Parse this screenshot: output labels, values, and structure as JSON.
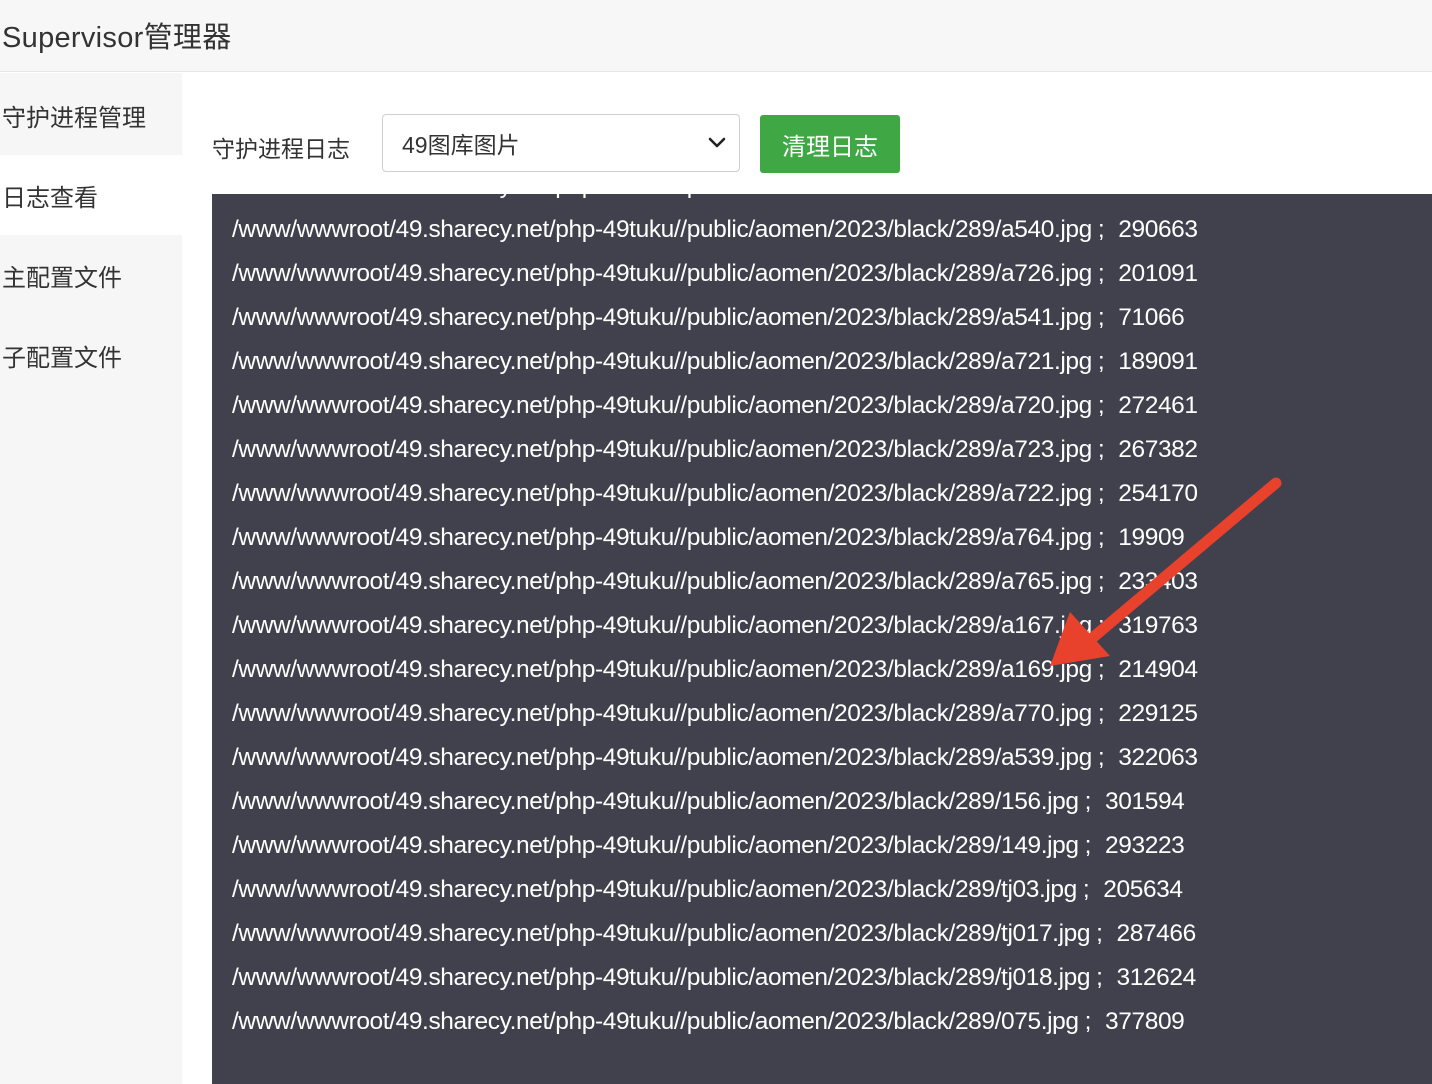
{
  "app": {
    "title": "Supervisor管理器"
  },
  "sidebar": {
    "items": [
      {
        "label": "守护进程管理"
      },
      {
        "label": "日志查看"
      },
      {
        "label": "主配置文件"
      },
      {
        "label": "子配置文件"
      }
    ]
  },
  "toolbar": {
    "label": "守护进程日志",
    "select_value": "49图库图片",
    "clear_label": "清理日志",
    "accent_color": "#3fa845"
  },
  "log": {
    "background": "#41414d",
    "lines": [
      {
        "path": "/www/wwwroot/49.sharecy.net/php-49tuku//public/aomen/2023/black/289/a540.jpg",
        "sep": ";",
        "size": "290663"
      },
      {
        "path": "/www/wwwroot/49.sharecy.net/php-49tuku//public/aomen/2023/black/289/a726.jpg",
        "sep": ";",
        "size": "201091"
      },
      {
        "path": "/www/wwwroot/49.sharecy.net/php-49tuku//public/aomen/2023/black/289/a541.jpg",
        "sep": ";",
        "size": "71066"
      },
      {
        "path": "/www/wwwroot/49.sharecy.net/php-49tuku//public/aomen/2023/black/289/a721.jpg",
        "sep": ";",
        "size": "189091"
      },
      {
        "path": "/www/wwwroot/49.sharecy.net/php-49tuku//public/aomen/2023/black/289/a720.jpg",
        "sep": ";",
        "size": "272461"
      },
      {
        "path": "/www/wwwroot/49.sharecy.net/php-49tuku//public/aomen/2023/black/289/a723.jpg",
        "sep": ";",
        "size": "267382"
      },
      {
        "path": "/www/wwwroot/49.sharecy.net/php-49tuku//public/aomen/2023/black/289/a722.jpg",
        "sep": ";",
        "size": "254170"
      },
      {
        "path": "/www/wwwroot/49.sharecy.net/php-49tuku//public/aomen/2023/black/289/a764.jpg",
        "sep": ";",
        "size": "19909"
      },
      {
        "path": "/www/wwwroot/49.sharecy.net/php-49tuku//public/aomen/2023/black/289/a765.jpg",
        "sep": ";",
        "size": "233403"
      },
      {
        "path": "/www/wwwroot/49.sharecy.net/php-49tuku//public/aomen/2023/black/289/a167.jpg",
        "sep": ";",
        "size": "319763"
      },
      {
        "path": "/www/wwwroot/49.sharecy.net/php-49tuku//public/aomen/2023/black/289/a169.jpg",
        "sep": ";",
        "size": "214904"
      },
      {
        "path": "/www/wwwroot/49.sharecy.net/php-49tuku//public/aomen/2023/black/289/a770.jpg",
        "sep": ";",
        "size": "229125"
      },
      {
        "path": "/www/wwwroot/49.sharecy.net/php-49tuku//public/aomen/2023/black/289/a539.jpg",
        "sep": ";",
        "size": "322063"
      },
      {
        "path": "/www/wwwroot/49.sharecy.net/php-49tuku//public/aomen/2023/black/289/156.jpg",
        "sep": ";",
        "size": "301594"
      },
      {
        "path": "/www/wwwroot/49.sharecy.net/php-49tuku//public/aomen/2023/black/289/149.jpg",
        "sep": ";",
        "size": "293223"
      },
      {
        "path": "/www/wwwroot/49.sharecy.net/php-49tuku//public/aomen/2023/black/289/tj03.jpg",
        "sep": ";",
        "size": "205634"
      },
      {
        "path": "/www/wwwroot/49.sharecy.net/php-49tuku//public/aomen/2023/black/289/tj017.jpg",
        "sep": ";",
        "size": "287466"
      },
      {
        "path": "/www/wwwroot/49.sharecy.net/php-49tuku//public/aomen/2023/black/289/tj018.jpg",
        "sep": ";",
        "size": "312624"
      },
      {
        "path": "/www/wwwroot/49.sharecy.net/php-49tuku//public/aomen/2023/black/289/075.jpg",
        "sep": ";",
        "size": "377809"
      }
    ]
  },
  "annotation": {
    "arrow_color": "#e8412c"
  }
}
